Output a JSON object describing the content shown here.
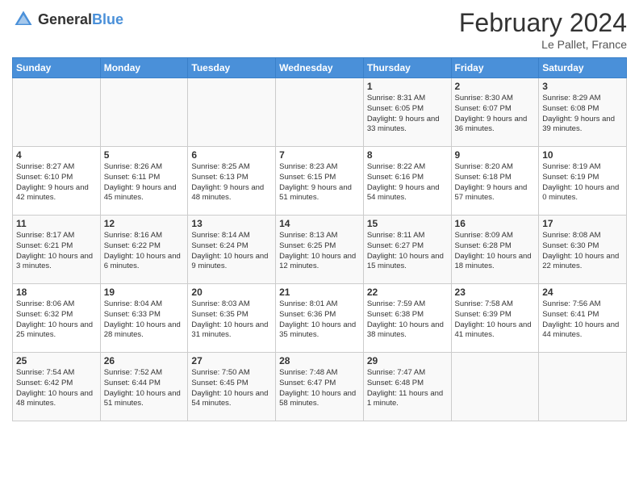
{
  "header": {
    "logo_general": "General",
    "logo_blue": "Blue",
    "title": "February 2024",
    "location": "Le Pallet, France"
  },
  "weekdays": [
    "Sunday",
    "Monday",
    "Tuesday",
    "Wednesday",
    "Thursday",
    "Friday",
    "Saturday"
  ],
  "weeks": [
    [
      {
        "day": "",
        "info": ""
      },
      {
        "day": "",
        "info": ""
      },
      {
        "day": "",
        "info": ""
      },
      {
        "day": "",
        "info": ""
      },
      {
        "day": "1",
        "info": "Sunrise: 8:31 AM\nSunset: 6:05 PM\nDaylight: 9 hours and 33 minutes."
      },
      {
        "day": "2",
        "info": "Sunrise: 8:30 AM\nSunset: 6:07 PM\nDaylight: 9 hours and 36 minutes."
      },
      {
        "day": "3",
        "info": "Sunrise: 8:29 AM\nSunset: 6:08 PM\nDaylight: 9 hours and 39 minutes."
      }
    ],
    [
      {
        "day": "4",
        "info": "Sunrise: 8:27 AM\nSunset: 6:10 PM\nDaylight: 9 hours and 42 minutes."
      },
      {
        "day": "5",
        "info": "Sunrise: 8:26 AM\nSunset: 6:11 PM\nDaylight: 9 hours and 45 minutes."
      },
      {
        "day": "6",
        "info": "Sunrise: 8:25 AM\nSunset: 6:13 PM\nDaylight: 9 hours and 48 minutes."
      },
      {
        "day": "7",
        "info": "Sunrise: 8:23 AM\nSunset: 6:15 PM\nDaylight: 9 hours and 51 minutes."
      },
      {
        "day": "8",
        "info": "Sunrise: 8:22 AM\nSunset: 6:16 PM\nDaylight: 9 hours and 54 minutes."
      },
      {
        "day": "9",
        "info": "Sunrise: 8:20 AM\nSunset: 6:18 PM\nDaylight: 9 hours and 57 minutes."
      },
      {
        "day": "10",
        "info": "Sunrise: 8:19 AM\nSunset: 6:19 PM\nDaylight: 10 hours and 0 minutes."
      }
    ],
    [
      {
        "day": "11",
        "info": "Sunrise: 8:17 AM\nSunset: 6:21 PM\nDaylight: 10 hours and 3 minutes."
      },
      {
        "day": "12",
        "info": "Sunrise: 8:16 AM\nSunset: 6:22 PM\nDaylight: 10 hours and 6 minutes."
      },
      {
        "day": "13",
        "info": "Sunrise: 8:14 AM\nSunset: 6:24 PM\nDaylight: 10 hours and 9 minutes."
      },
      {
        "day": "14",
        "info": "Sunrise: 8:13 AM\nSunset: 6:25 PM\nDaylight: 10 hours and 12 minutes."
      },
      {
        "day": "15",
        "info": "Sunrise: 8:11 AM\nSunset: 6:27 PM\nDaylight: 10 hours and 15 minutes."
      },
      {
        "day": "16",
        "info": "Sunrise: 8:09 AM\nSunset: 6:28 PM\nDaylight: 10 hours and 18 minutes."
      },
      {
        "day": "17",
        "info": "Sunrise: 8:08 AM\nSunset: 6:30 PM\nDaylight: 10 hours and 22 minutes."
      }
    ],
    [
      {
        "day": "18",
        "info": "Sunrise: 8:06 AM\nSunset: 6:32 PM\nDaylight: 10 hours and 25 minutes."
      },
      {
        "day": "19",
        "info": "Sunrise: 8:04 AM\nSunset: 6:33 PM\nDaylight: 10 hours and 28 minutes."
      },
      {
        "day": "20",
        "info": "Sunrise: 8:03 AM\nSunset: 6:35 PM\nDaylight: 10 hours and 31 minutes."
      },
      {
        "day": "21",
        "info": "Sunrise: 8:01 AM\nSunset: 6:36 PM\nDaylight: 10 hours and 35 minutes."
      },
      {
        "day": "22",
        "info": "Sunrise: 7:59 AM\nSunset: 6:38 PM\nDaylight: 10 hours and 38 minutes."
      },
      {
        "day": "23",
        "info": "Sunrise: 7:58 AM\nSunset: 6:39 PM\nDaylight: 10 hours and 41 minutes."
      },
      {
        "day": "24",
        "info": "Sunrise: 7:56 AM\nSunset: 6:41 PM\nDaylight: 10 hours and 44 minutes."
      }
    ],
    [
      {
        "day": "25",
        "info": "Sunrise: 7:54 AM\nSunset: 6:42 PM\nDaylight: 10 hours and 48 minutes."
      },
      {
        "day": "26",
        "info": "Sunrise: 7:52 AM\nSunset: 6:44 PM\nDaylight: 10 hours and 51 minutes."
      },
      {
        "day": "27",
        "info": "Sunrise: 7:50 AM\nSunset: 6:45 PM\nDaylight: 10 hours and 54 minutes."
      },
      {
        "day": "28",
        "info": "Sunrise: 7:48 AM\nSunset: 6:47 PM\nDaylight: 10 hours and 58 minutes."
      },
      {
        "day": "29",
        "info": "Sunrise: 7:47 AM\nSunset: 6:48 PM\nDaylight: 11 hours and 1 minute."
      },
      {
        "day": "",
        "info": ""
      },
      {
        "day": "",
        "info": ""
      }
    ]
  ]
}
